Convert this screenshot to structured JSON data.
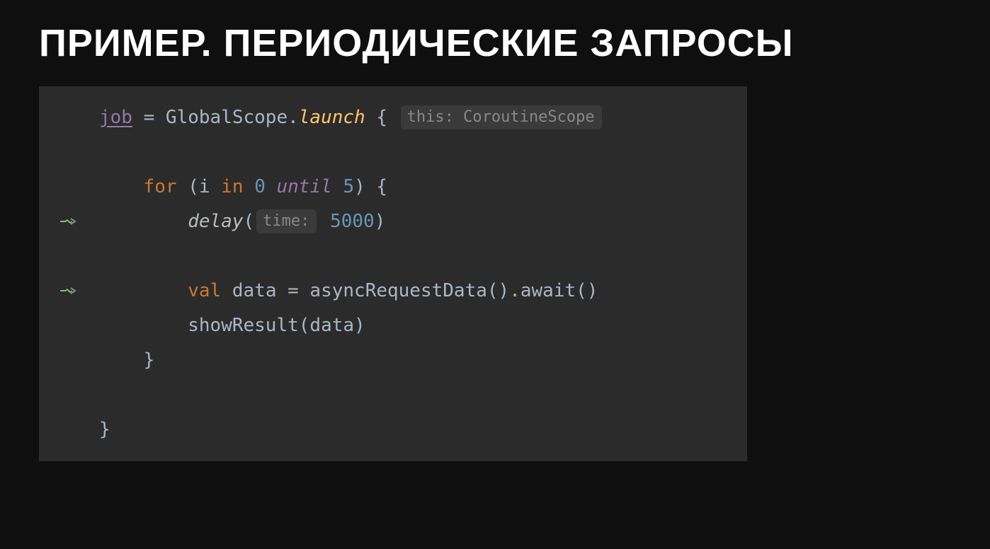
{
  "slide": {
    "title": "ПРИМЕР. ПЕРИОДИЧЕСКИЕ ЗАПРОСЫ"
  },
  "code": {
    "line1": {
      "job": "job",
      "eq": " = GlobalScope.",
      "launch": "launch",
      "brace": " { ",
      "hint": "this: CoroutineScope"
    },
    "line3": {
      "for": "for",
      "paren": " (i ",
      "in": "in",
      "sp1": " ",
      "zero": "0",
      "sp2": " ",
      "until": "until",
      "sp3": " ",
      "five": "5",
      "end": ") {"
    },
    "line4": {
      "delay": "delay",
      "open": "(",
      "hint": "time:",
      "sp": " ",
      "val": "5000",
      "close": ")"
    },
    "line6": {
      "val": "val",
      "rest": " data = asyncRequestData().await()"
    },
    "line7": {
      "text": "showResult(data)"
    },
    "line8": {
      "text": "}"
    },
    "line10": {
      "text": "}"
    }
  }
}
